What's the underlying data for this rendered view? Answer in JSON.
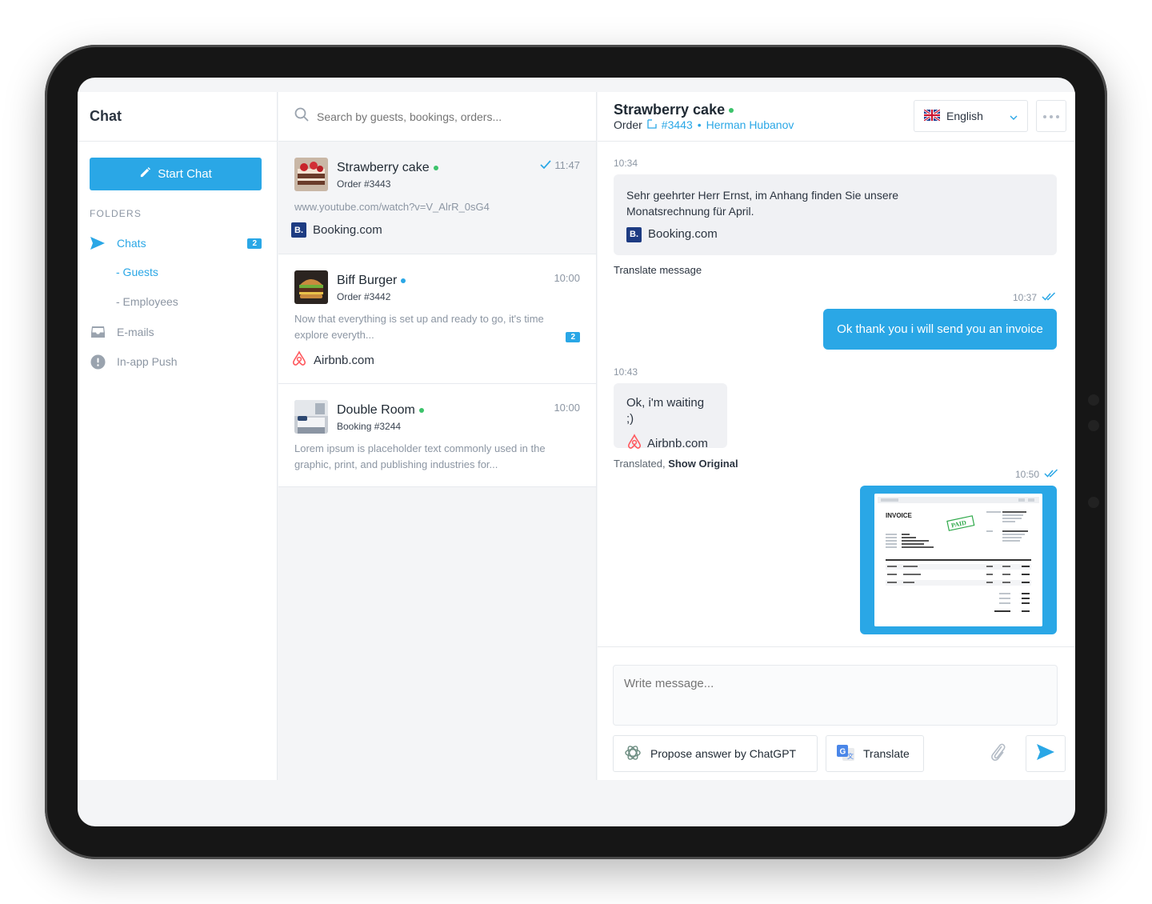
{
  "sidebar": {
    "title": "Chat",
    "start_chat_label": "Start Chat",
    "folders_label": "FOLDERS",
    "items": [
      {
        "label": "Chats",
        "badge": "2",
        "icon": "send-icon"
      },
      {
        "label": "- Guests"
      },
      {
        "label": "- Employees"
      },
      {
        "label": "E-mails",
        "icon": "inbox-icon"
      },
      {
        "label": "In-app Push",
        "icon": "alert-icon"
      }
    ]
  },
  "search": {
    "placeholder": "Search by guests, bookings, orders..."
  },
  "conversations": [
    {
      "title": "Strawberry cake",
      "subtitle": "Order #3443",
      "time": "11:47",
      "preview": "www.youtube.com/watch?v=V_AlrR_0sG4",
      "source": "Booking.com",
      "source_logo": "B."
    },
    {
      "title": "Biff Burger",
      "subtitle": "Order #3442",
      "time": "10:00",
      "preview": "Now that everything is set up and ready to go, it's time explore everyth...",
      "source": "Airbnb.com",
      "badge": "2"
    },
    {
      "title": "Double Room",
      "subtitle": "Booking #3244",
      "time": "10:00",
      "preview": "Lorem ipsum is placeholder text commonly used in the graphic, print, and publishing industries for..."
    }
  ],
  "chat": {
    "title": "Strawberry cake",
    "sub_label": "Order",
    "order_link": "#3443",
    "separator": "•",
    "customer_name": "Herman Hubanov",
    "language": "English",
    "messages": [
      {
        "time": "10:34",
        "text": "Sehr geehrter Herr Ernst, im Anhang finden Sie unsere Monatsrechnung für April.",
        "source": "Booking.com",
        "source_logo": "B.",
        "action": "Translate message"
      },
      {
        "time": "10:37",
        "text": "Ok thank you i will send you an invoice"
      },
      {
        "time": "10:43",
        "text": "Ok, i'm waiting ;)",
        "source": "Airbnb.com",
        "translated_label": "Translated,",
        "show_original": "Show Original"
      },
      {
        "time": "10:50",
        "attachment": {
          "heading": "INVOICE",
          "stamp": "PAID"
        }
      }
    ],
    "composer": {
      "placeholder": "Write message...",
      "chatgpt_label": "Propose answer by ChatGPT",
      "translate_label": "Translate"
    }
  },
  "colors": {
    "accent": "#2aa7e6",
    "online": "#3cc36b",
    "booking": "#1d3b82",
    "airbnb": "#ff5a5f"
  }
}
